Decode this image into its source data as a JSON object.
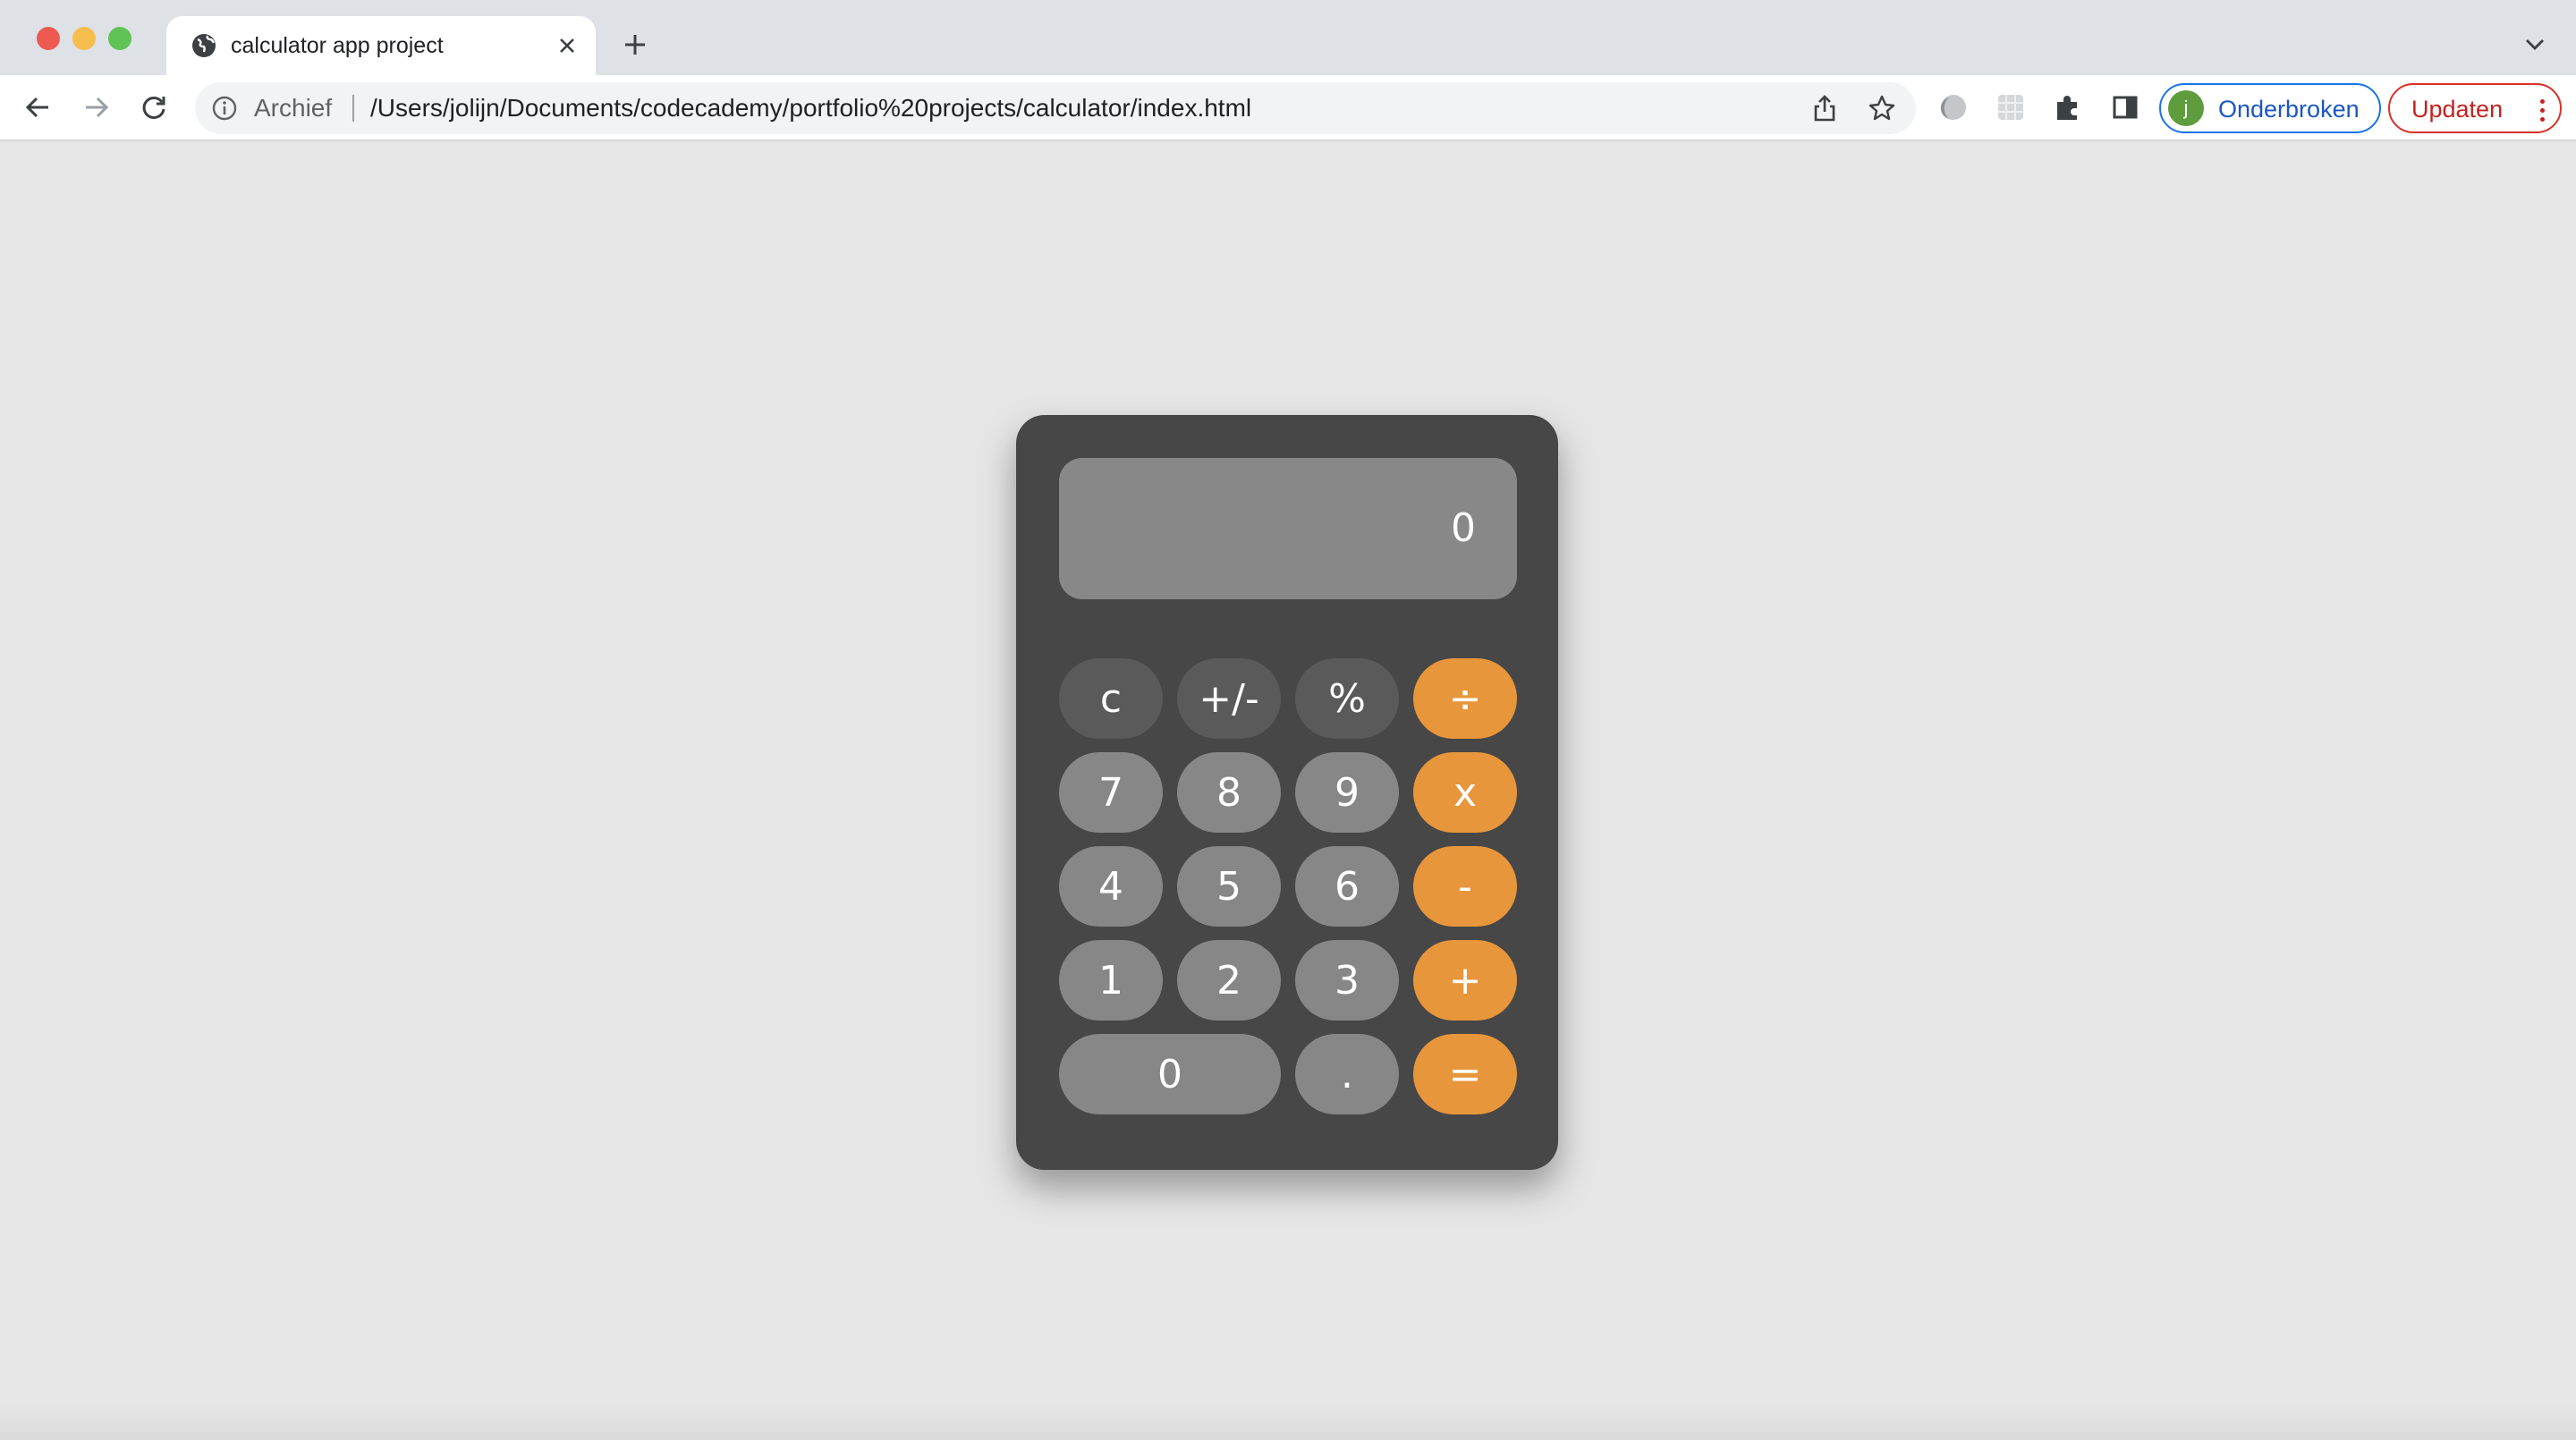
{
  "tab": {
    "title": "calculator app project",
    "favicon": "globe-icon"
  },
  "toolbar": {
    "omnibox_chip": "Archief",
    "url": "/Users/jolijn/Documents/codecademy/portfolio%20projects/calculator/index.html",
    "profile_initial": "j",
    "profile_label": "Onderbroken",
    "update_label": "Updaten"
  },
  "calculator": {
    "display": "0",
    "keys": {
      "clear": "c",
      "negate": "+/-",
      "percent": "%",
      "divide": "÷",
      "seven": "7",
      "eight": "8",
      "nine": "9",
      "multiply": "x",
      "four": "4",
      "five": "5",
      "six": "6",
      "subtract": "-",
      "one": "1",
      "two": "2",
      "three": "3",
      "add": "+",
      "zero": "0",
      "decimal": ".",
      "equals": "="
    }
  },
  "colors": {
    "page_background": "#e6e6e6",
    "calculator_body": "#474747",
    "display_background": "#888888",
    "function_key": "#5a5a5a",
    "number_key": "#878787",
    "operator_key": "#e8963b"
  }
}
